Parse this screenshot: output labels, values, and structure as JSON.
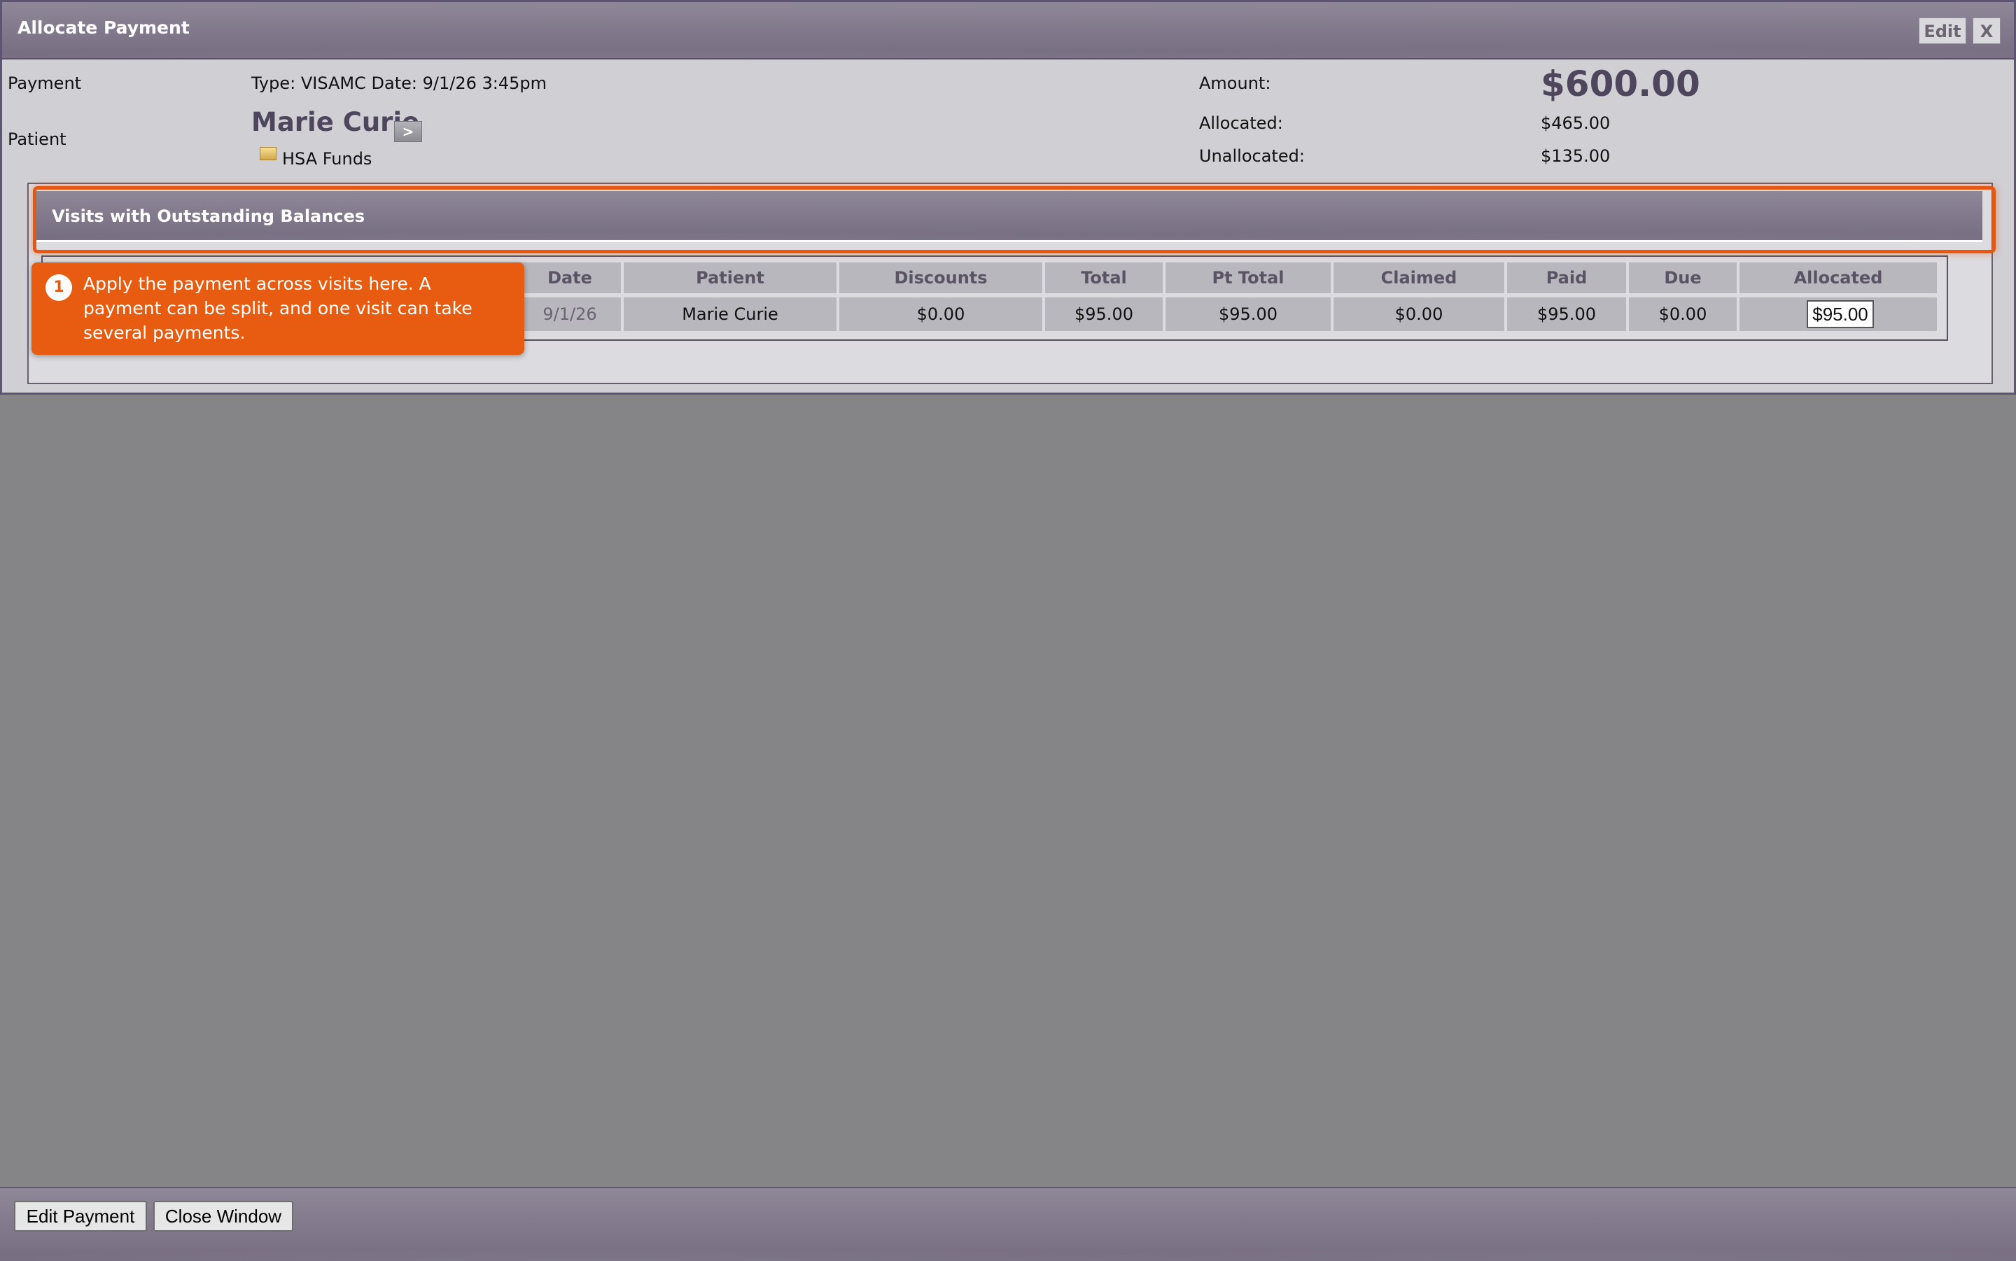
{
  "dialog": {
    "title": "Allocate Payment",
    "edit_button": "Edit",
    "close_button": "X"
  },
  "payment": {
    "label": "Payment",
    "info": "Type: VISAMC Date: 9/1/26 3:45pm",
    "amount_label": "Amount:",
    "amount_value": "$600.00",
    "allocated_label": "Allocated:",
    "allocated_value": "$465.00",
    "unallocated_label": "Unallocated:",
    "unallocated_value": "$135.00"
  },
  "patient": {
    "label": "Patient",
    "name": "Marie Curie",
    "link_button": ">",
    "fund_label": "HSA Funds"
  },
  "visits": {
    "title": "Visits with Outstanding Balances",
    "columns": [
      "Date",
      "Patient",
      "Discounts",
      "Total",
      "Pt Total",
      "Claimed",
      "Paid",
      "Due",
      "Allocated"
    ],
    "rows": [
      {
        "date": "9/1/26",
        "patient": "Marie Curie",
        "discounts": "$0.00",
        "total": "$95.00",
        "pt_total": "$95.00",
        "claimed": "$0.00",
        "paid": "$95.00",
        "due": "$0.00",
        "allocated": "$95.00"
      }
    ]
  },
  "tour": {
    "step": "1",
    "text": "Apply the payment across visits here. A payment can be split, and one visit can take several payments.",
    "accent_color": "#e75c10"
  },
  "footer": {
    "edit_payment": "Edit Payment",
    "close_window": "Close Window"
  }
}
